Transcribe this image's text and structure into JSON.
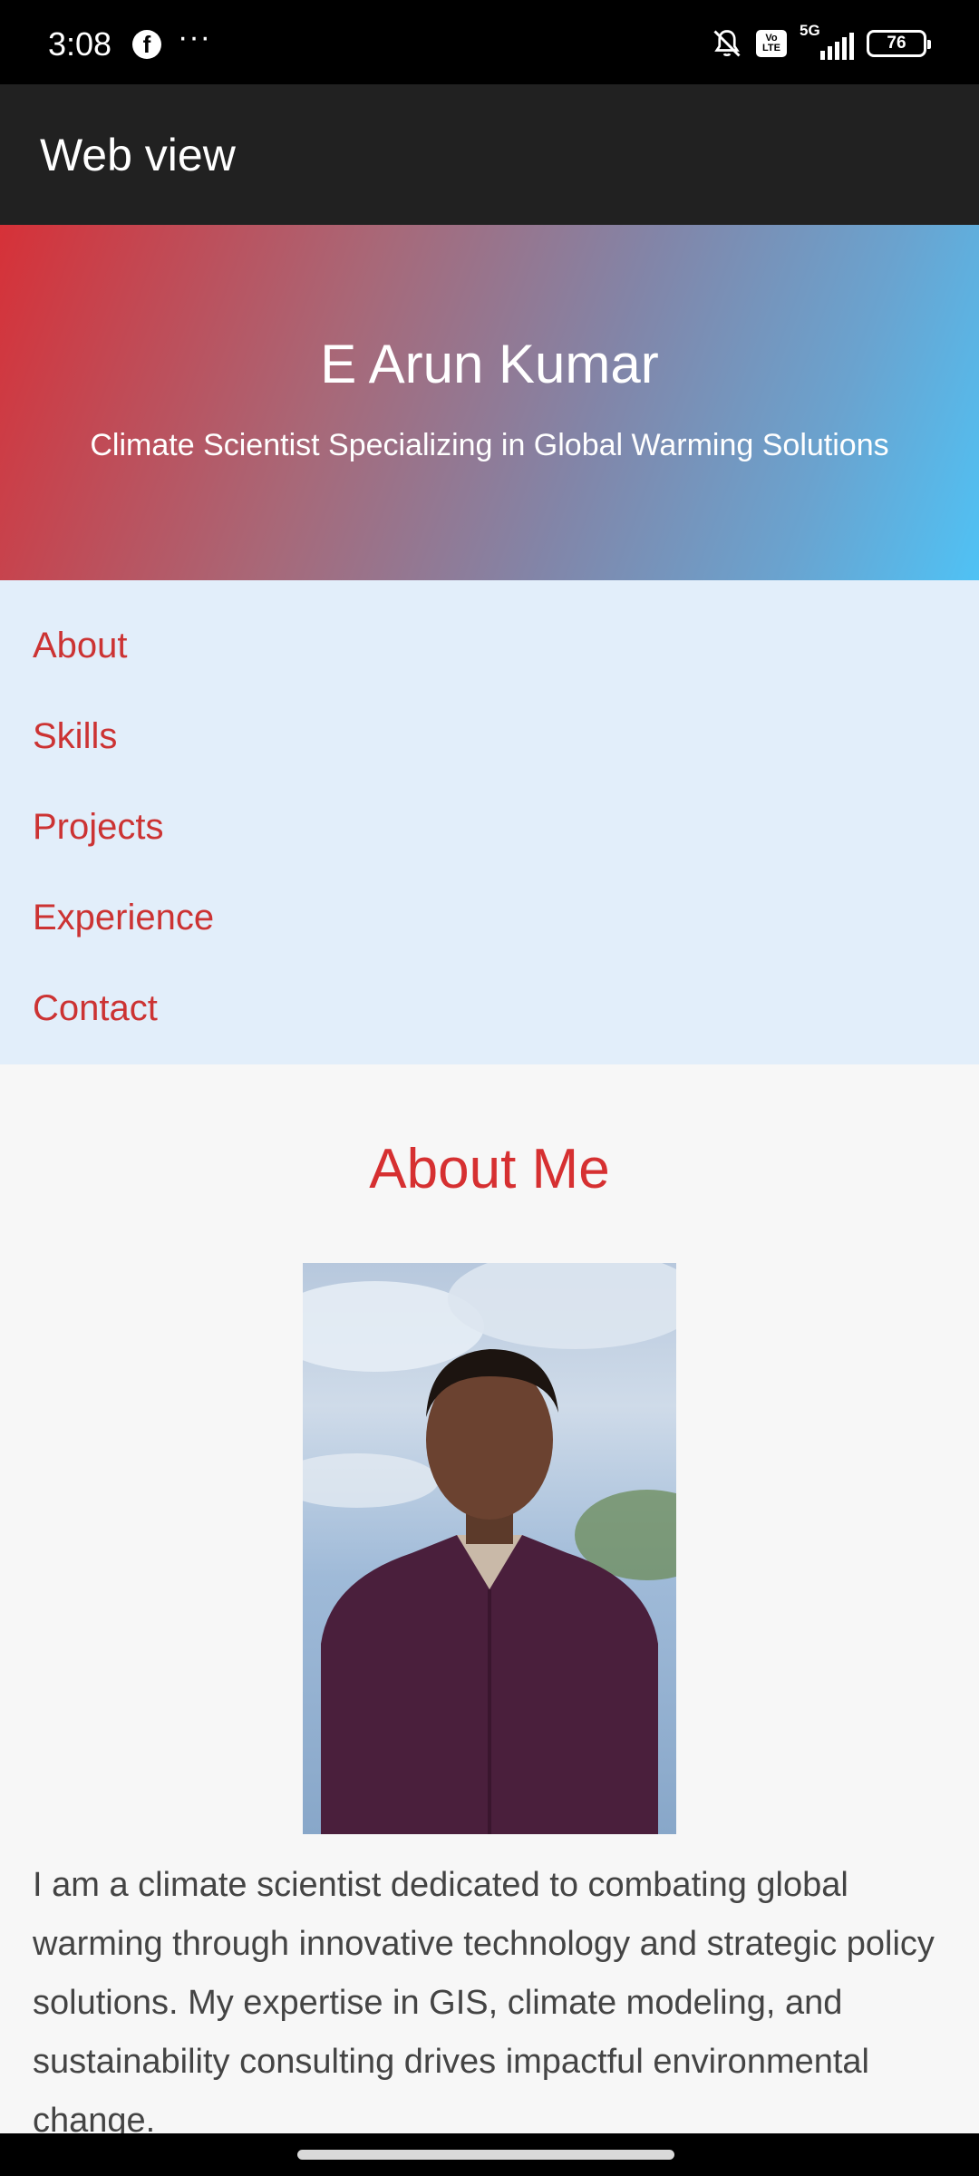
{
  "status_bar": {
    "time": "3:08",
    "facebook_glyph": "f",
    "more": "···",
    "volte_top": "Vo",
    "volte_bottom": "LTE",
    "network": "5G",
    "battery": "76",
    "icons": [
      "facebook-icon",
      "more-icon",
      "bell-muted-icon",
      "volte-icon",
      "signal-icon",
      "battery-icon"
    ]
  },
  "app_bar": {
    "title": "Web view"
  },
  "hero": {
    "name": "E Arun Kumar",
    "tagline": "Climate Scientist Specializing in Global Warming Solutions"
  },
  "nav": {
    "items": [
      {
        "label": "About"
      },
      {
        "label": "Skills"
      },
      {
        "label": "Projects"
      },
      {
        "label": "Experience"
      },
      {
        "label": "Contact"
      }
    ]
  },
  "about": {
    "title": "About Me",
    "text": "I am a climate scientist dedicated to combating global warming through innovative technology and strategic policy solutions. My expertise in GIS, climate modeling, and sustainability consulting drives impactful environmental change."
  },
  "colors": {
    "accent": "#d63031",
    "nav_bg": "#e2eefa",
    "hero_start": "#d63138",
    "hero_end": "#4fc2f5",
    "app_bar": "#212121"
  }
}
